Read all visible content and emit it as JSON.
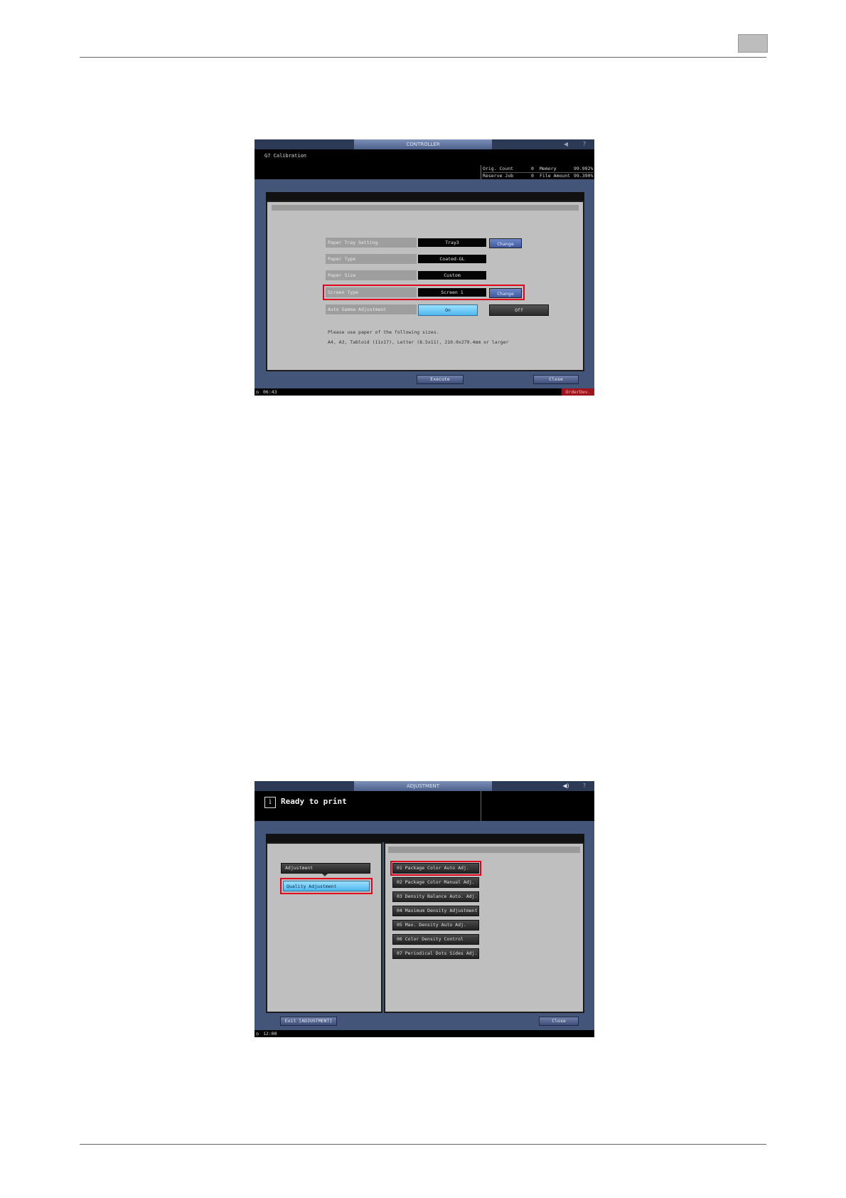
{
  "screen1": {
    "tab_title": "CONTROLLER",
    "message": "G7 Calibration",
    "stats": {
      "orig_count_label": "Orig. Count",
      "orig_count_value": "0",
      "memory_label": "Memory",
      "memory_value": "99.992%",
      "reserve_job_label": "Reserve Job",
      "reserve_job_value": "0",
      "file_amount_label": "File Amount",
      "file_amount_value": "99.390%"
    },
    "settings": [
      {
        "label": "Paper Tray Setting",
        "value": "Tray3",
        "button": "Change"
      },
      {
        "label": "Paper Type",
        "value": "Coated-GL"
      },
      {
        "label": "Paper Size",
        "value": "Custom"
      },
      {
        "label": "Screen Type",
        "value": "Screen 1",
        "button": "Change"
      },
      {
        "label": "Auto Gamma Adjustment",
        "on_label": "On",
        "off_label": "Off"
      }
    ],
    "info_line1": "Please use paper of the following sizes.",
    "info_line2": "A4, A3, Tabloid (11x17), Letter (8.5x11), 210.0x279.4mm or larger",
    "execute_button": "Execute",
    "close_button": "Close",
    "clock": "06:43",
    "order_dev": "OrderDev."
  },
  "screen2": {
    "tab_title": "ADJUSTMENT",
    "info_icon": "i",
    "message": "Ready to print",
    "left_menu": {
      "adjustment": "Adjustment",
      "quality_adjustment": "Quality Adjustment"
    },
    "right_menu": [
      "01 Package Color Auto Adj.",
      "02 Package Color Manual Adj.",
      "03 Density Balance Auto. Adj.",
      "04 Maximum Density Adjustment",
      "05 Max. Density Auto Adj.",
      "06 Color Density Control",
      "07 Periodical Dots Sides Adj."
    ],
    "exit_button": "Exit [ADJUSTMENT]",
    "close_button": "Close",
    "clock": "12:00"
  }
}
